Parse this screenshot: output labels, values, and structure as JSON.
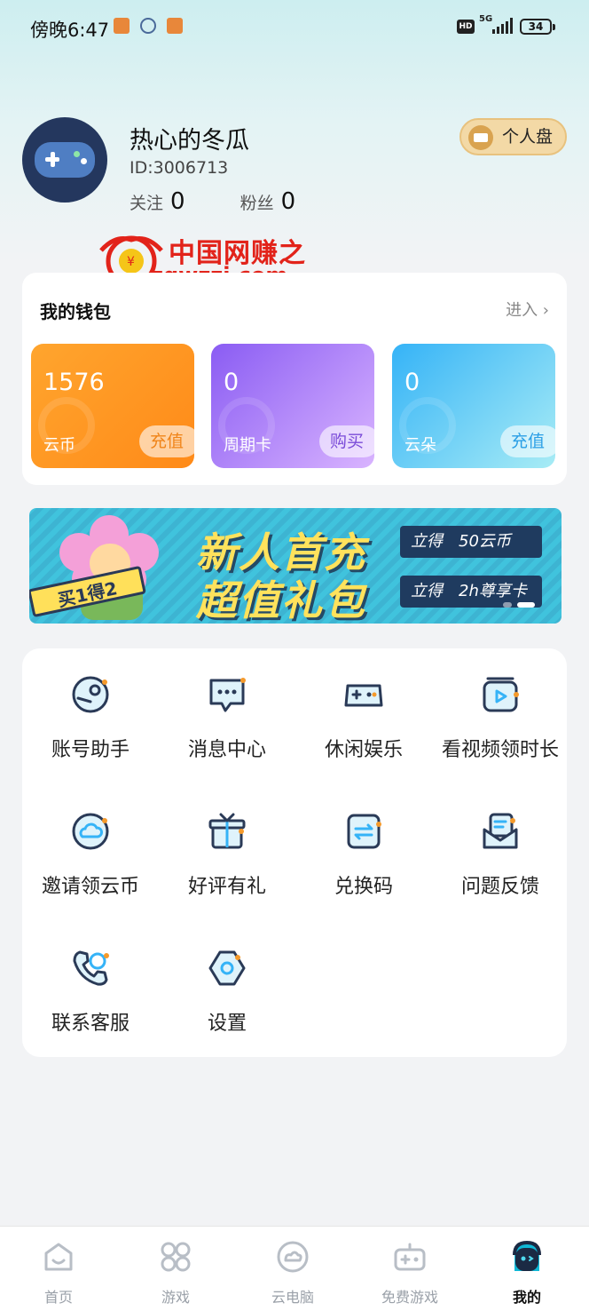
{
  "status_bar": {
    "time": "傍晚6:47",
    "hd": "HD",
    "network": "5G",
    "battery": "34"
  },
  "profile": {
    "username": "热心的冬瓜",
    "id": "ID:3006713",
    "follow_label": "关注",
    "follow_count": "0",
    "fans_label": "粉丝",
    "fans_count": "0",
    "disk_button": "个人盘"
  },
  "watermark": {
    "cn": "中国网赚之家",
    "en": "zgwzzj.com"
  },
  "wallet": {
    "title": "我的钱包",
    "enter": "进入 ›",
    "cards": [
      {
        "value": "1576",
        "label": "云币",
        "action": "充值"
      },
      {
        "value": "0",
        "label": "周期卡",
        "action": "购买"
      },
      {
        "value": "0",
        "label": "云朵",
        "action": "充值"
      }
    ]
  },
  "banner": {
    "badge": "买1得2",
    "headline_1": "新人首充",
    "headline_2": "超值礼包",
    "ticket_1_prefix": "立得",
    "ticket_1_value": "50云币",
    "ticket_2_prefix": "立得",
    "ticket_2_value": "2h尊享卡"
  },
  "menu": [
    {
      "label": "账号助手",
      "icon": "steam-icon"
    },
    {
      "label": "消息中心",
      "icon": "message-icon"
    },
    {
      "label": "休闲娱乐",
      "icon": "gamepad-icon"
    },
    {
      "label": "看视频领时长",
      "icon": "video-icon"
    },
    {
      "label": "邀请领云币",
      "icon": "cloud-icon"
    },
    {
      "label": "好评有礼",
      "icon": "gift-icon"
    },
    {
      "label": "兑换码",
      "icon": "exchange-icon"
    },
    {
      "label": "问题反馈",
      "icon": "feedback-icon"
    },
    {
      "label": "联系客服",
      "icon": "phone-icon"
    },
    {
      "label": "设置",
      "icon": "settings-icon"
    }
  ],
  "tabs": [
    {
      "label": "首页",
      "icon": "home-icon"
    },
    {
      "label": "游戏",
      "icon": "games-grid-icon"
    },
    {
      "label": "云电脑",
      "icon": "cloud-pc-icon"
    },
    {
      "label": "免费游戏",
      "icon": "controller-icon"
    },
    {
      "label": "我的",
      "icon": "mine-ghost-icon",
      "active": true
    }
  ],
  "colors": {
    "accent_orange": "#ff8a18",
    "accent_purple": "#8a5cf3",
    "accent_blue": "#35b3f7",
    "dark_navy": "#2a3a57",
    "watermark_red": "#e2231a"
  }
}
